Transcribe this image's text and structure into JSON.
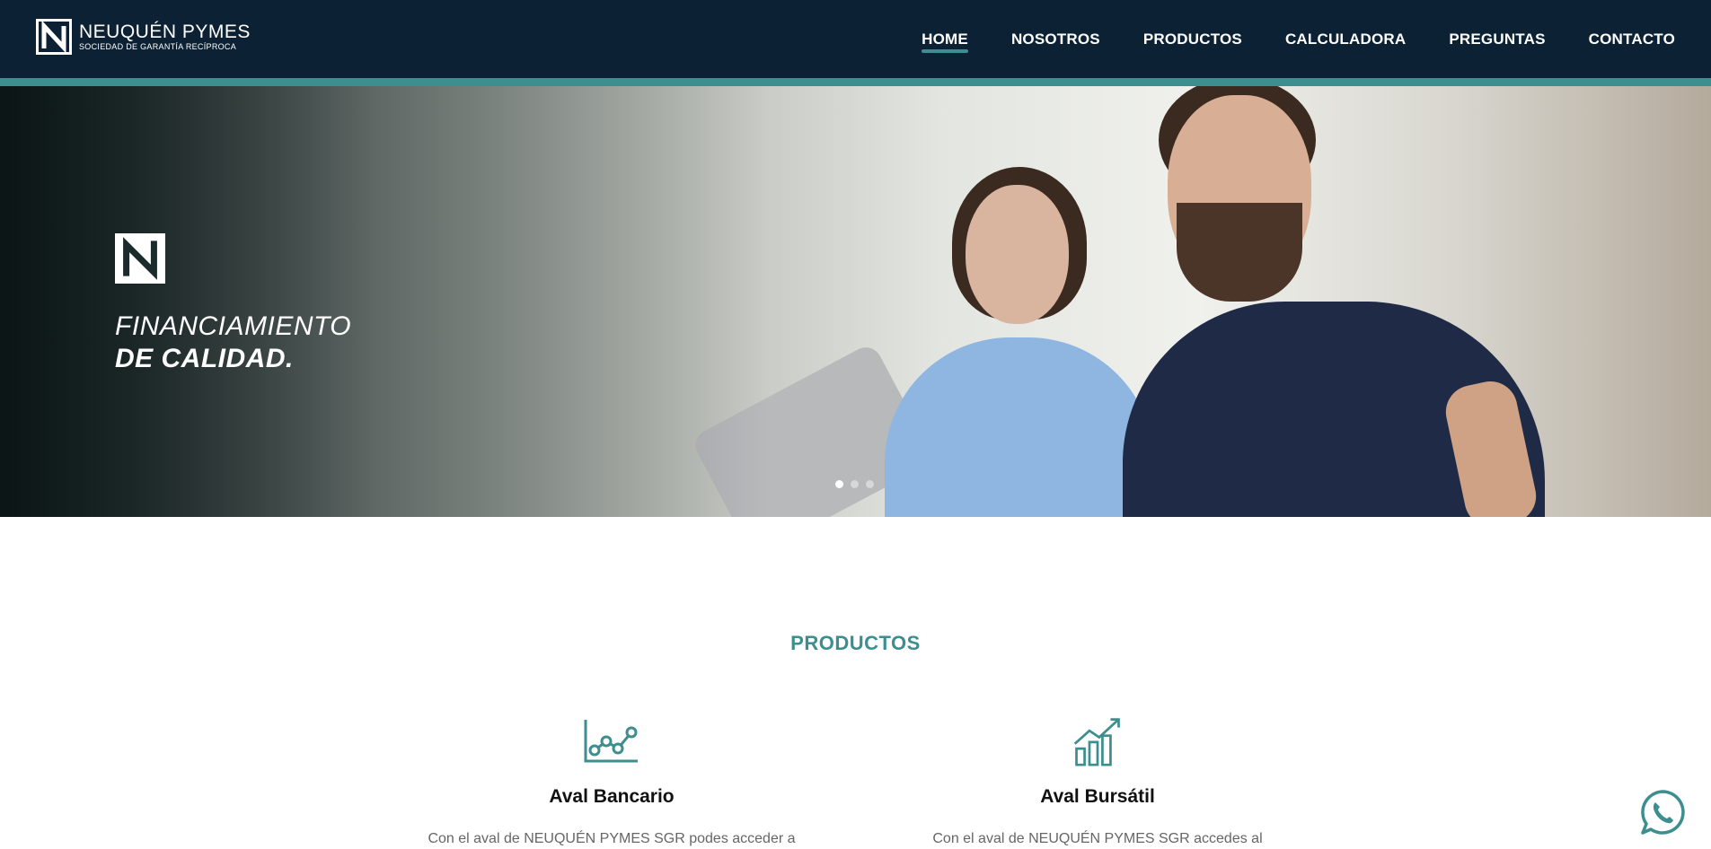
{
  "colors": {
    "header_bg": "#0c2234",
    "accent": "#3d8e8f",
    "text_dark": "#111111",
    "text_muted": "#666666"
  },
  "header": {
    "logo": {
      "icon": "n-logo-icon",
      "name": "NEUQUÉN PYMES",
      "tagline": "SOCIEDAD DE GARANTÍA RECÍPROCA"
    },
    "nav": [
      {
        "label": "HOME",
        "active": true
      },
      {
        "label": "NOSOTROS",
        "active": false
      },
      {
        "label": "PRODUCTOS",
        "active": false
      },
      {
        "label": "CALCULADORA",
        "active": false
      },
      {
        "label": "PREGUNTAS",
        "active": false
      },
      {
        "label": "CONTACTO",
        "active": false
      }
    ]
  },
  "hero": {
    "emblem_icon": "n-logo-icon",
    "title_line1": "FINANCIAMIENTO",
    "title_line2": "DE CALIDAD.",
    "slides_total": 3,
    "slide_active": 1
  },
  "products": {
    "title": "PRODUCTOS",
    "items": [
      {
        "icon": "line-chart-icon",
        "name": "Aval Bancario",
        "desc": "Con el aval de NEUQUÉN PYMES SGR podes acceder a"
      },
      {
        "icon": "bar-chart-growth-icon",
        "name": "Aval Bursátil",
        "desc": "Con el aval de NEUQUÉN PYMES SGR accedes al"
      }
    ]
  },
  "floating": {
    "icon": "whatsapp-icon"
  }
}
